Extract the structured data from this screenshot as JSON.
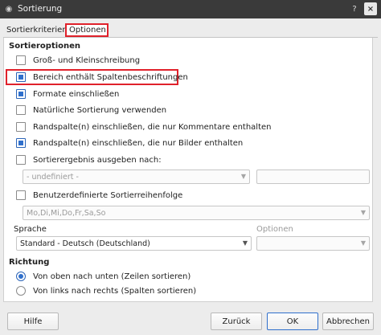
{
  "window": {
    "title": "Sortierung",
    "help_glyph": "?",
    "close_glyph": "×"
  },
  "tabs": [
    {
      "label": "Sortierkriterien"
    },
    {
      "label": "Optionen"
    }
  ],
  "sections": {
    "options_title": "Sortieroptionen",
    "direction_title": "Richtung"
  },
  "options": {
    "case_sensitive": {
      "label": "Groß- und Kleinschreibung",
      "checked": false
    },
    "has_headers": {
      "label": "Bereich enthält Spaltenbeschriftungen",
      "checked": true
    },
    "include_formats": {
      "label": "Formate einschließen",
      "checked": true
    },
    "natural_sort": {
      "label": "Natürliche Sortierung verwenden",
      "checked": false
    },
    "include_comment_cols": {
      "label": "Randspalte(n) einschließen, die nur Kommentare enthalten",
      "checked": false
    },
    "include_image_cols": {
      "label": "Randspalte(n) einschließen, die nur Bilder enthalten",
      "checked": true
    },
    "copy_output": {
      "label": "Sortierergebnis ausgeben nach:",
      "checked": false
    },
    "output_select": {
      "value": "- undefiniert -"
    },
    "output_input": {
      "value": ""
    },
    "custom_order": {
      "label": "Benutzerdefinierte Sortierreihenfolge",
      "checked": false
    },
    "custom_order_select": {
      "value": "Mo,Di,Mi,Do,Fr,Sa,So"
    }
  },
  "language": {
    "label": "Sprache",
    "value": "Standard - Deutsch (Deutschland)",
    "options_label": "Optionen",
    "options_value": ""
  },
  "direction": {
    "top_to_bottom": {
      "label": "Von oben nach unten (Zeilen sortieren)",
      "checked": true
    },
    "left_to_right": {
      "label": "Von links nach rechts (Spalten sortieren)",
      "checked": false
    }
  },
  "buttons": {
    "help": "Hilfe",
    "reset": "Zurück",
    "ok": "OK",
    "cancel": "Abbrechen"
  },
  "colors": {
    "highlight": "#e0212b",
    "accent": "#2f6fcc",
    "titlebar": "#3a3a3a"
  }
}
